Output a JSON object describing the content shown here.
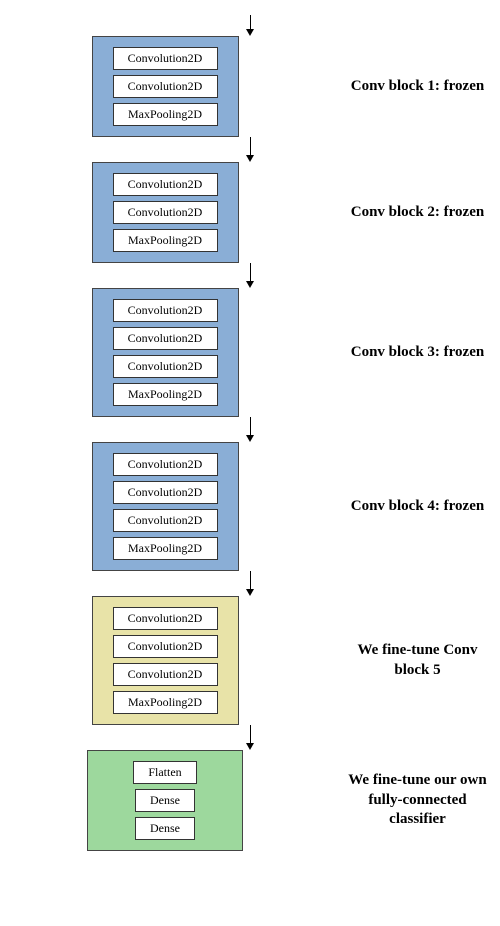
{
  "layers": {
    "conv": "Convolution2D",
    "pool": "MaxPooling2D",
    "flatten": "Flatten",
    "dense": "Dense"
  },
  "labels": {
    "block1": "Conv block 1: frozen",
    "block2": "Conv block 2: frozen",
    "block3": "Conv block 3: frozen",
    "block4": "Conv block 4: frozen",
    "block5": "We fine-tune Conv block 5",
    "classifier": "We fine-tune our own fully-connected classifier"
  }
}
